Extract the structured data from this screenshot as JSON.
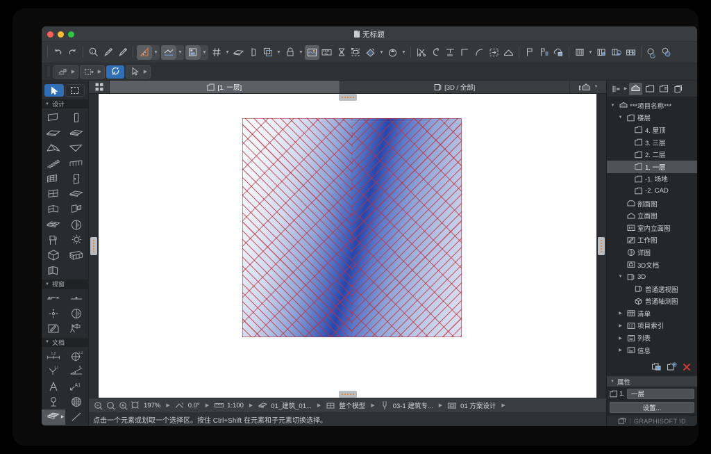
{
  "window": {
    "title": "无标题",
    "title_icon": "document-icon"
  },
  "traffic_lights": {
    "close": "#ff5f57",
    "minimize": "#febc2e",
    "maximize": "#28c840"
  },
  "toolbar_main": {
    "groups": [
      {
        "items": [
          {
            "name": "undo-button",
            "icon": "undo-arrow-icon",
            "state": "normal"
          },
          {
            "name": "redo-button",
            "icon": "redo-arrow-icon",
            "state": "normal"
          }
        ]
      },
      {
        "items": [
          {
            "name": "zoom-tool-button",
            "icon": "magnifier-icon",
            "state": "normal"
          },
          {
            "name": "eyedropper-pick-button",
            "icon": "eyedropper-icon",
            "state": "normal"
          },
          {
            "name": "eyedropper-inject-button",
            "icon": "syringe-icon",
            "state": "normal"
          }
        ]
      },
      {
        "items": [
          {
            "name": "measure-tool-button",
            "icon": "triangle-ruler-icon",
            "state": "active",
            "has_caret": true
          },
          {
            "name": "align-tool-button",
            "icon": "align-icon",
            "state": "active",
            "has_caret": true
          },
          {
            "name": "label-tool-button",
            "icon": "text-label-icon",
            "state": "active",
            "has_caret": true
          }
        ]
      },
      {
        "items": [
          {
            "name": "grid-snap-button",
            "icon": "grid-hash-icon",
            "state": "normal",
            "has_caret": true
          },
          {
            "name": "slab-tool-button",
            "icon": "slab-icon",
            "state": "normal"
          },
          {
            "name": "wall-tool-button",
            "icon": "wall-icon",
            "state": "normal"
          },
          {
            "name": "copy-layers-button",
            "icon": "stacked-squares-icon",
            "state": "normal",
            "has_caret": true
          },
          {
            "name": "lock-button",
            "icon": "padlock-icon",
            "state": "normal",
            "has_caret": true
          },
          {
            "name": "render-view-button",
            "icon": "render-image-icon",
            "state": "active"
          },
          {
            "name": "dimension-button",
            "icon": "ruler-numbers-icon",
            "state": "normal"
          },
          {
            "name": "node-edit-button",
            "icon": "node-hourglass-icon",
            "state": "normal"
          },
          {
            "name": "group-frame-button",
            "icon": "group-frame-icon",
            "state": "normal"
          },
          {
            "name": "material-button",
            "icon": "paint-cube-icon",
            "state": "normal",
            "has_caret": true
          },
          {
            "name": "drop-fill-button",
            "icon": "droplet-fill-icon",
            "state": "normal",
            "has_caret": true
          }
        ]
      },
      {
        "items": [
          {
            "name": "split-button",
            "icon": "scissors-split-icon",
            "state": "normal"
          },
          {
            "name": "magic-wand-button",
            "icon": "magic-wand-icon",
            "state": "normal"
          },
          {
            "name": "trim-button",
            "icon": "trim-icon",
            "state": "normal"
          },
          {
            "name": "corner-button",
            "icon": "corner-icon",
            "state": "normal"
          },
          {
            "name": "fillet-button",
            "icon": "fillet-arc-icon",
            "state": "normal"
          },
          {
            "name": "adjust-button",
            "icon": "adjust-box-icon",
            "state": "normal"
          },
          {
            "name": "roof-button",
            "icon": "roof-icon",
            "state": "normal"
          }
        ]
      },
      {
        "items": [
          {
            "name": "marker-button",
            "icon": "flag-icon",
            "state": "normal"
          },
          {
            "name": "list-marker-button",
            "icon": "flag-list-icon",
            "state": "normal"
          },
          {
            "name": "cloud-publish-button",
            "icon": "cloud-doc-icon",
            "state": "normal"
          }
        ]
      },
      {
        "items": [
          {
            "name": "library-button",
            "icon": "library-icon",
            "state": "normal",
            "has_caret": true
          },
          {
            "name": "library-info-button",
            "icon": "library-info-icon",
            "state": "normal"
          },
          {
            "name": "library-update-button",
            "icon": "library-refresh-icon",
            "state": "normal"
          },
          {
            "name": "hotlink-button",
            "icon": "hotlink-table-icon",
            "state": "normal"
          }
        ]
      },
      {
        "items": [
          {
            "name": "teamwork-send-button",
            "icon": "teamwork-send-icon",
            "state": "normal"
          },
          {
            "name": "teamwork-receive-button",
            "icon": "teamwork-receive-icon",
            "state": "normal"
          }
        ]
      }
    ]
  },
  "toolbar_second": {
    "items": [
      {
        "name": "pet-palette-offset-button",
        "icon": "offset-icon",
        "has_caret": true
      },
      {
        "name": "pet-palette-extend-button",
        "icon": "extend-icon",
        "has_caret": true
      },
      {
        "name": "rotate-tool-button",
        "icon": "rotate-icon",
        "state": "active-blue"
      },
      {
        "name": "arrow-select-button",
        "icon": "cursor-arrow-icon",
        "has_caret": true
      }
    ]
  },
  "left_palette": {
    "top_tools": [
      {
        "name": "arrow-tool",
        "icon": "cursor-arrow-icon",
        "selected": true
      },
      {
        "name": "marquee-tool",
        "icon": "marquee-dashed-icon",
        "selected": false
      }
    ],
    "sections": [
      {
        "name": "design",
        "label": "设计",
        "expanded": true,
        "tools": [
          {
            "name": "wall-tool",
            "icon": "wall-icon"
          },
          {
            "name": "column-tool",
            "icon": "column-icon"
          },
          {
            "name": "beam-tool",
            "icon": "beam-icon"
          },
          {
            "name": "slab-tool",
            "icon": "slab-icon"
          },
          {
            "name": "roof-tool",
            "icon": "roof-icon"
          },
          {
            "name": "shell-tool",
            "icon": "shell-icon"
          },
          {
            "name": "stair-tool",
            "icon": "stair-icon"
          },
          {
            "name": "railing-tool",
            "icon": "railing-icon"
          },
          {
            "name": "curtain-wall-tool",
            "icon": "curtain-wall-icon"
          },
          {
            "name": "door-tool",
            "icon": "door-icon"
          },
          {
            "name": "window-tool",
            "icon": "window-icon"
          },
          {
            "name": "skylight-tool",
            "icon": "skylight-icon"
          },
          {
            "name": "corner-window-tool",
            "icon": "corner-window-icon"
          },
          {
            "name": "wall-end-tool",
            "icon": "wall-end-icon"
          },
          {
            "name": "mesh-tool",
            "icon": "mesh-icon"
          },
          {
            "name": "zone-tool",
            "icon": "zone-pie-icon"
          },
          {
            "name": "object-tool",
            "icon": "chair-icon"
          },
          {
            "name": "lamp-tool",
            "icon": "lamp-icon"
          },
          {
            "name": "morph-tool",
            "icon": "morph-cube-icon"
          },
          {
            "name": "truss-tool",
            "icon": "truss-grid-icon"
          },
          {
            "name": "opening-tool",
            "icon": "opening-icon"
          }
        ]
      },
      {
        "name": "viewport",
        "label": "视窗",
        "expanded": true,
        "tools": [
          {
            "name": "section-tool",
            "icon": "section-marker-icon"
          },
          {
            "name": "elevation-tool",
            "icon": "elevation-marker-icon"
          },
          {
            "name": "interior-elevation-tool",
            "icon": "interior-elevation-icon"
          },
          {
            "name": "detail-tool",
            "icon": "detail-circle-icon"
          },
          {
            "name": "worksheet-tool",
            "icon": "worksheet-pencil-icon"
          },
          {
            "name": "camera-tool",
            "icon": "movie-camera-icon"
          }
        ]
      },
      {
        "name": "document",
        "label": "文档",
        "expanded": true,
        "tools": [
          {
            "name": "linear-dimension-tool",
            "icon": "linear-dimension-icon"
          },
          {
            "name": "radial-dimension-tool",
            "icon": "radial-dimension-icon"
          },
          {
            "name": "level-dimension-tool",
            "icon": "level-dimension-icon"
          },
          {
            "name": "angle-dimension-tool",
            "icon": "angle-dimension-icon"
          },
          {
            "name": "text-tool",
            "icon": "text-a-icon"
          },
          {
            "name": "label-tool",
            "icon": "label-a1-icon"
          },
          {
            "name": "zone-stamp-tool",
            "icon": "zone-stamp-icon"
          },
          {
            "name": "fill-tool",
            "icon": "fill-paint-icon"
          },
          {
            "name": "hatch-tool",
            "icon": "hatch-pattern-icon",
            "highlighted": true,
            "has_flyout": true
          },
          {
            "name": "line-tool",
            "icon": "line-icon"
          }
        ]
      }
    ]
  },
  "tabbar": {
    "grid_button": {
      "name": "tab-grid-view-button",
      "icon": "grid-four-squares-icon"
    },
    "tabs": [
      {
        "name": "tab-floor-plan",
        "label": "[1. 一层]",
        "icon": "floor-plan-icon",
        "active": true
      },
      {
        "name": "tab-3d-all",
        "label": "[3D / 全部]",
        "icon": "3d-view-icon",
        "active": false
      }
    ],
    "right_button": {
      "name": "view-style-button",
      "icon": "building-3d-icon",
      "has_caret": true
    }
  },
  "canvas": {
    "artwork_name": "hatched-fill-polygon",
    "fill_colors": {
      "hatch_line": "#c62e38",
      "gradient_light": "#ffffff",
      "gradient_dark": "#2647ad"
    }
  },
  "statusbar": {
    "items": [
      {
        "name": "zoom-out-button",
        "icon": "zoom-out-icon",
        "type": "icon"
      },
      {
        "name": "zoom-previous-button",
        "icon": "zoom-prev-icon",
        "type": "icon"
      },
      {
        "name": "zoom-in-button",
        "icon": "zoom-in-icon",
        "type": "icon"
      },
      {
        "name": "fit-in-window-button",
        "icon": "fit-window-icon",
        "type": "icon"
      },
      {
        "name": "zoom-level",
        "value": "197%",
        "type": "value",
        "caret": true
      },
      {
        "name": "orientation-icon",
        "icon": "orientation-icon",
        "type": "icon"
      },
      {
        "name": "orientation-angle",
        "value": "0.0°",
        "type": "value",
        "caret": true
      },
      {
        "name": "scale-icon",
        "icon": "scale-ruler-icon",
        "type": "icon"
      },
      {
        "name": "drawing-scale",
        "value": "1:100",
        "type": "value",
        "caret": true
      },
      {
        "name": "layer-combo-icon",
        "icon": "layers-icon",
        "type": "icon"
      },
      {
        "name": "layer-combination",
        "value": "01_建筑_01...",
        "type": "value",
        "caret": true
      },
      {
        "name": "structure-display-icon",
        "icon": "structure-icon",
        "type": "icon"
      },
      {
        "name": "structure-display",
        "value": "整个模型",
        "type": "value",
        "caret": true
      },
      {
        "name": "penset-icon",
        "icon": "pen-icon",
        "type": "icon"
      },
      {
        "name": "pen-set",
        "value": "03-1 建筑专...",
        "type": "value",
        "caret": true
      },
      {
        "name": "model-view-icon",
        "icon": "model-view-icon",
        "type": "icon"
      },
      {
        "name": "model-view-options",
        "value": "01 方案设计",
        "type": "value",
        "caret": true
      }
    ]
  },
  "message_bar": {
    "text": "点击一个元素或划取一个选择区。按住 Ctrl+Shift 在元素和子元素切换选择。"
  },
  "navigator": {
    "header": {
      "settings_button": {
        "name": "navigator-settings-button",
        "icon": "navigator-settings-icon",
        "has_caret": true
      },
      "view_buttons": [
        {
          "name": "project-map-button",
          "icon": "project-map-home-icon",
          "active": true
        },
        {
          "name": "view-map-button",
          "icon": "view-map-icon",
          "active": false
        },
        {
          "name": "layout-book-button",
          "icon": "layout-book-icon",
          "active": false
        },
        {
          "name": "publisher-sets-button",
          "icon": "publisher-sets-icon",
          "active": false
        }
      ]
    },
    "tree": [
      {
        "label": "***项目名称***",
        "depth": 0,
        "twisty": "open",
        "icon": "project-home-icon",
        "selected": false
      },
      {
        "label": "楼层",
        "depth": 1,
        "twisty": "open",
        "icon": "stories-folder-icon",
        "selected": false
      },
      {
        "label": "4. 屋顶",
        "depth": 2,
        "twisty": "none",
        "icon": "story-icon",
        "selected": false
      },
      {
        "label": "3. 三层",
        "depth": 2,
        "twisty": "none",
        "icon": "story-icon",
        "selected": false
      },
      {
        "label": "2. 二层",
        "depth": 2,
        "twisty": "none",
        "icon": "story-icon",
        "selected": false
      },
      {
        "label": "1. 一层",
        "depth": 2,
        "twisty": "none",
        "icon": "story-icon",
        "selected": true
      },
      {
        "label": "-1. 场地",
        "depth": 2,
        "twisty": "none",
        "icon": "story-icon",
        "selected": false
      },
      {
        "label": "-2. CAD",
        "depth": 2,
        "twisty": "none",
        "icon": "story-icon",
        "selected": false
      },
      {
        "label": "剖面图",
        "depth": 1,
        "twisty": "none",
        "icon": "section-folder-icon",
        "selected": false
      },
      {
        "label": "立面图",
        "depth": 1,
        "twisty": "none",
        "icon": "elevation-folder-icon",
        "selected": false
      },
      {
        "label": "室内立面图",
        "depth": 1,
        "twisty": "none",
        "icon": "interior-elevation-folder-icon",
        "selected": false
      },
      {
        "label": "工作图",
        "depth": 1,
        "twisty": "none",
        "icon": "worksheet-folder-icon",
        "selected": false
      },
      {
        "label": "详图",
        "depth": 1,
        "twisty": "none",
        "icon": "detail-folder-icon",
        "selected": false
      },
      {
        "label": "3D文档",
        "depth": 1,
        "twisty": "none",
        "icon": "3d-document-folder-icon",
        "selected": false
      },
      {
        "label": "3D",
        "depth": 1,
        "twisty": "open",
        "icon": "3d-folder-icon",
        "selected": false
      },
      {
        "label": "普通透视图",
        "depth": 2,
        "twisty": "none",
        "icon": "perspective-icon",
        "selected": false
      },
      {
        "label": "普通轴测图",
        "depth": 2,
        "twisty": "none",
        "icon": "axonometric-icon",
        "selected": false
      },
      {
        "label": "清单",
        "depth": 1,
        "twisty": "closed",
        "icon": "schedule-folder-icon",
        "selected": false
      },
      {
        "label": "项目索引",
        "depth": 1,
        "twisty": "closed",
        "icon": "project-index-icon",
        "selected": false
      },
      {
        "label": "列表",
        "depth": 1,
        "twisty": "closed",
        "icon": "lists-icon",
        "selected": false
      },
      {
        "label": "信息",
        "depth": 1,
        "twisty": "closed",
        "icon": "info-icon",
        "selected": false
      }
    ],
    "action_icons": [
      {
        "name": "clone-folder-button",
        "icon": "clone-folder-icon"
      },
      {
        "name": "new-view-button",
        "icon": "new-view-plus-icon"
      },
      {
        "name": "delete-button",
        "icon": "red-x-icon",
        "color": "#e03b30"
      }
    ]
  },
  "properties": {
    "header_label": "属性",
    "row": {
      "icon": "story-icon",
      "index": "1.",
      "value": "一层"
    },
    "settings_button_label": "设置..."
  },
  "footer": {
    "icon": "teamwork-box-icon",
    "brand": "GRAPHISOFT",
    "brand_suffix": "ID"
  }
}
